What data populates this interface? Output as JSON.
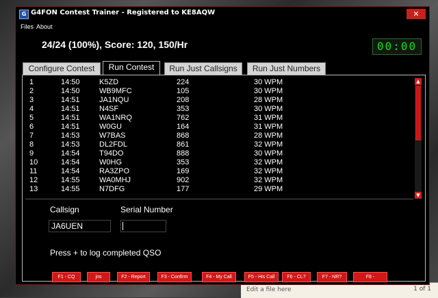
{
  "window": {
    "title": "G4FON Contest Trainer - Registered to KE8AQW",
    "icon": "G",
    "close_glyph": "✕"
  },
  "menu": [
    "Files",
    "About"
  ],
  "status": {
    "score_text": "24/24 (100%), Score: 120, 150/Hr",
    "timer": "00:00"
  },
  "tabs": [
    {
      "label": "Configure Contest",
      "active": false
    },
    {
      "label": "Run Contest",
      "active": true
    },
    {
      "label": "Run Just Callsigns",
      "active": false
    },
    {
      "label": "Run Just Numbers",
      "active": false
    }
  ],
  "log": {
    "rows": [
      [
        "1",
        "14:50",
        "K5ZD",
        "224",
        "30 WPM"
      ],
      [
        "2",
        "14:50",
        "WB9MFC",
        "105",
        "30 WPM"
      ],
      [
        "3",
        "14:51",
        "JA1NQU",
        "208",
        "28 WPM"
      ],
      [
        "4",
        "14:51",
        "N4SF",
        "353",
        "30 WPM"
      ],
      [
        "5",
        "14:51",
        "WA1NRQ",
        "762",
        "31 WPM"
      ],
      [
        "6",
        "14:51",
        "W0GU",
        "164",
        "31 WPM"
      ],
      [
        "7",
        "14:53",
        "W7BAS",
        "868",
        "28 WPM"
      ],
      [
        "8",
        "14:53",
        "DL2FDL",
        "861",
        "32 WPM"
      ],
      [
        "9",
        "14:54",
        "T94DO",
        "888",
        "30 WPM"
      ],
      [
        "10",
        "14:54",
        "W0HG",
        "353",
        "32 WPM"
      ],
      [
        "11",
        "14:54",
        "RA3ZPO",
        "169",
        "32 WPM"
      ],
      [
        "12",
        "14:55",
        "WA0MHJ",
        "902",
        "32 WPM"
      ],
      [
        "13",
        "14:55",
        "N7DFG",
        "177",
        "29 WPM"
      ]
    ]
  },
  "entry": {
    "callsign_label": "Callsign",
    "serial_label": "Serial Number",
    "callsign_value": "JA6UEN",
    "serial_value": "",
    "hint": "Press + to log completed QSO"
  },
  "function_keys": [
    "F1 - CQ",
    "jns",
    "F2 - Report",
    "F3 - Confirm",
    "F4 - My Call",
    "F5 - His Call",
    "F6 - CL?",
    "F7 - NR?",
    "F8 -"
  ],
  "background_doc": {
    "text": "Edit a file here",
    "pager": "1 of 1"
  },
  "colors": {
    "accent_red": "#d01818",
    "timer_green": "#18e018",
    "window_bg": "#000000"
  }
}
